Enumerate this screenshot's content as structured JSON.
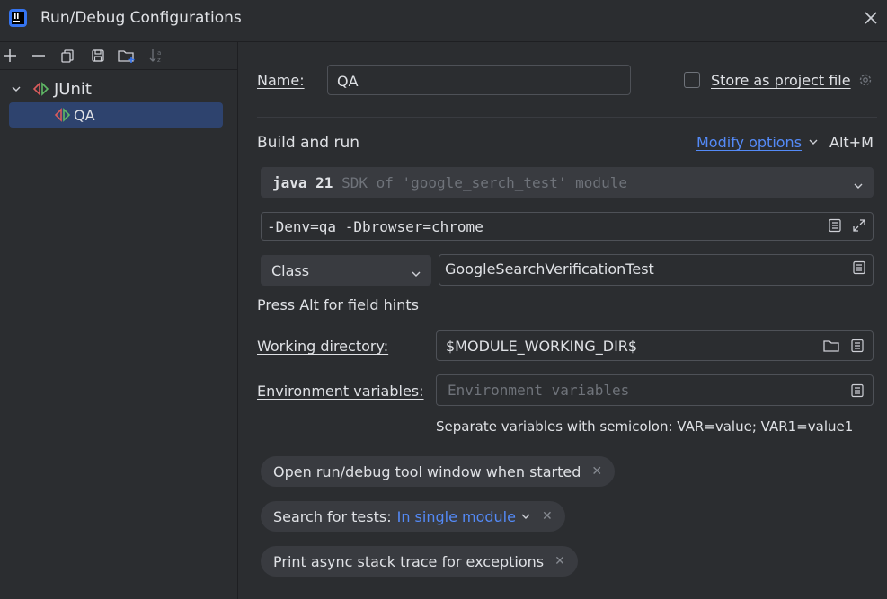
{
  "window": {
    "title": "Run/Debug Configurations"
  },
  "tree": {
    "group_label": "JUnit",
    "items": [
      {
        "label": "QA"
      }
    ]
  },
  "form": {
    "name_label": "Name:",
    "name_value": "QA",
    "store_label": "Store as project file",
    "section_title": "Build and run",
    "modify_options": "Modify options",
    "modify_shortcut": "Alt+M",
    "jdk_bold": "java 21",
    "jdk_dim": "SDK of 'google_serch_test' module",
    "vm_options": "-Denv=qa -Dbrowser=chrome",
    "test_kind": "Class",
    "class_value": "GoogleSearchVerificationTest",
    "hint": "Press Alt for field hints",
    "workdir_label": "Working directory:",
    "workdir_value": "$MODULE_WORKING_DIR$",
    "env_label": "Environment variables:",
    "env_placeholder": "Environment variables",
    "env_hint": "Separate variables with semicolon: VAR=value; VAR1=value1"
  },
  "chips": {
    "open_tool_window": "Open run/debug tool window when started",
    "search_label": "Search for tests:",
    "search_value": "In single module",
    "async_trace": "Print async stack trace for exceptions"
  },
  "colors": {
    "background": "#2b2d30",
    "accent": "#548af7",
    "selection": "#2e436e",
    "chip": "#393b40"
  }
}
